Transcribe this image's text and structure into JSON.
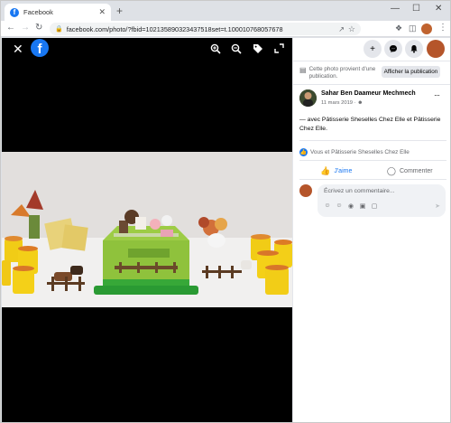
{
  "browser": {
    "tab_title": "Facebook",
    "tab_close": "✕",
    "new_tab": "+",
    "win_minimize": "—",
    "win_maximize": "☐",
    "win_close": "✕",
    "back": "←",
    "forward": "→",
    "reload": "↻",
    "url": "facebook.com/photo/?fbid=102135890323437518set=t.100010768057678",
    "icons": [
      "lock-icon",
      "share-icon",
      "star-icon",
      "puzzle-icon",
      "sidepanel-icon",
      "kebab-icon"
    ]
  },
  "viewer": {
    "close": "✕",
    "logo": "f",
    "tools": [
      "zoom-in-icon",
      "zoom-out-icon",
      "tag-icon",
      "fullscreen-icon"
    ]
  },
  "panel": {
    "top_icons": [
      "plus-icon",
      "messenger-icon",
      "bell-icon"
    ],
    "notice_text": "Cette photo provient d'une publication.",
    "notice_button": "Afficher la publication",
    "author": "Sahar Ben Daameur Mechmech",
    "date": "11 mars 2019 · ",
    "more": "···",
    "caption": "— avec Pâtisserie Sheselles Chez Elle et Pâtisserie Chez Elle.",
    "reactions_text": "Vous et Pâtisserie Sheselles Chez Elle",
    "like_label": "J'aime",
    "comment_label": "Commenter",
    "comment_placeholder": "Écrivez un commentaire...",
    "comment_icons": [
      "gif-icon",
      "emoji-icon",
      "camera-icon",
      "gif-icon",
      "sticker-icon"
    ]
  },
  "colors": {
    "facebook_blue": "#1877f2",
    "viewer_bg": "#000000",
    "muted_text": "#65676b"
  }
}
